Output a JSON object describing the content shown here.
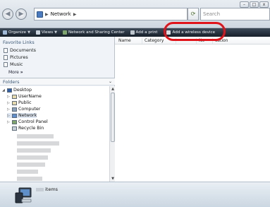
{
  "address": {
    "path": "Network",
    "separator_icon": "chevron-right"
  },
  "search": {
    "placeholder": "Search"
  },
  "toolbar": {
    "organize": "Organize",
    "views": "Views",
    "network_center": "Network and Sharing Center",
    "add_printer": "Add a print",
    "add_wireless": "Add a wireless device"
  },
  "sidebar": {
    "favorites_header": "Favorite Links",
    "favorites": [
      "Documents",
      "Pictures",
      "Music"
    ],
    "more": "More",
    "folders_header": "Folders",
    "tree": [
      "Desktop",
      "UserName",
      "Public",
      "Computer",
      "Network",
      "Control Panel",
      "Recycle Bin"
    ]
  },
  "columns": [
    "Name",
    "Category",
    "",
    "Ne",
    "cation"
  ],
  "details": {
    "items_label": "items"
  },
  "annotation": {
    "color": "#e0141a"
  }
}
